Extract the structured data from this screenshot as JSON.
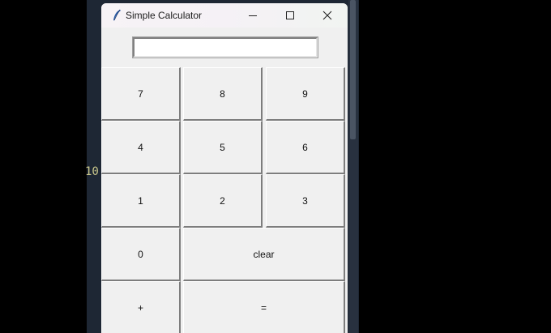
{
  "editor": {
    "line_number": "10"
  },
  "window": {
    "title": "Simple Calculator",
    "controls": {
      "minimize": "minimize-icon",
      "maximize": "maximize-icon",
      "close": "close-icon"
    }
  },
  "display": {
    "value": ""
  },
  "buttons": {
    "seven": "7",
    "eight": "8",
    "nine": "9",
    "four": "4",
    "five": "5",
    "six": "6",
    "one": "1",
    "two": "2",
    "three": "3",
    "zero": "0",
    "clear": "clear",
    "plus": "+",
    "equals": "="
  }
}
